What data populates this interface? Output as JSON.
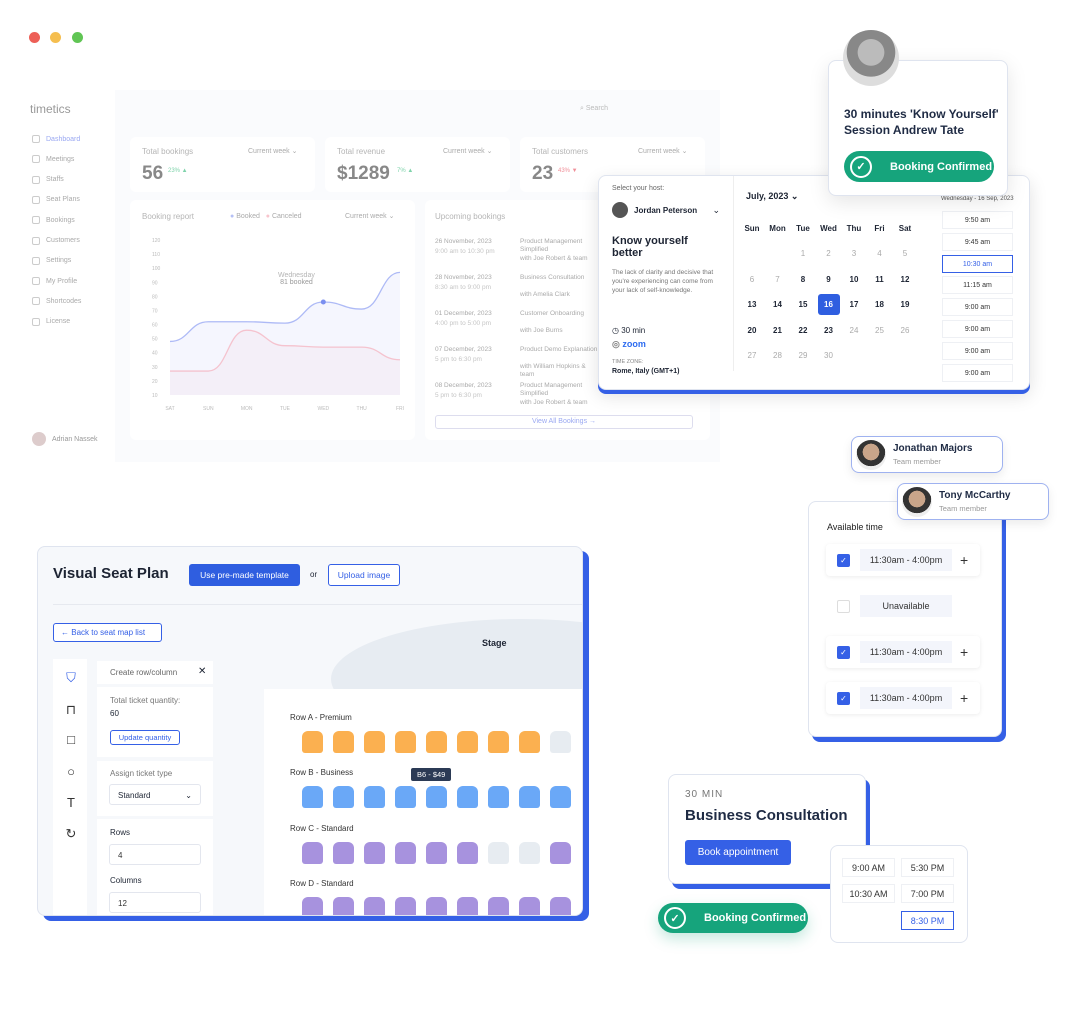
{
  "window": {
    "dots": [
      "#ed5f57",
      "#f5be4f",
      "#60c554"
    ]
  },
  "dashboard": {
    "logo": "timetics",
    "search_placeholder": "Search",
    "sidebar": [
      "Dashboard",
      "Meetings",
      "Staffs",
      "Seat Plans",
      "Bookings",
      "Customers",
      "Settings",
      "My Profile",
      "Shortcodes",
      "License"
    ],
    "user": "Adrian Nassek",
    "stats": [
      {
        "label": "Total bookings",
        "period": "Current week",
        "value": "56",
        "change": "23%",
        "trend": "up"
      },
      {
        "label": "Total revenue",
        "period": "Current week",
        "value": "$1289",
        "change": "7%",
        "trend": "up"
      },
      {
        "label": "Total customers",
        "period": "Current week",
        "value": "23",
        "change": "43%",
        "trend": "down"
      }
    ],
    "report": {
      "title": "Booking report",
      "legend_booked": "Booked",
      "legend_canceled": "Canceled",
      "period": "Current week",
      "tooltip_day": "Wednesday",
      "tooltip_value": "81 booked"
    },
    "upcoming": {
      "title": "Upcoming bookings",
      "view_all": "View All Bookings →",
      "items": [
        {
          "date": "26 November, 2023",
          "time": "9:00 am to 10:30 pm",
          "title": "Product Management Simplified",
          "with": "with Joe Robert & team"
        },
        {
          "date": "28 November, 2023",
          "time": "8:30 am to 9:00 pm",
          "title": "Business Consultation",
          "with": "with Amelia Clark"
        },
        {
          "date": "01 December, 2023",
          "time": "4:00 pm to 5:00 pm",
          "title": "Customer Onboarding",
          "with": "with Joe Burns"
        },
        {
          "date": "07 December, 2023",
          "time": "5 pm to 6:30 pm",
          "title": "Product Demo Explanation",
          "with": "with William Hopkins & team"
        },
        {
          "date": "08 December, 2023",
          "time": "5 pm to 6:30 pm",
          "title": "Product Management Simplified",
          "with": "with Joe Robert & team"
        }
      ]
    }
  },
  "chart_data": {
    "type": "line",
    "categories": [
      "SAT",
      "SUN",
      "MON",
      "TUE",
      "WED",
      "THU",
      "FRI"
    ],
    "yticks": [
      10,
      20,
      30,
      40,
      50,
      60,
      70,
      80,
      90,
      100,
      110,
      120
    ],
    "ylim": [
      10,
      120
    ],
    "series": [
      {
        "name": "Booked",
        "color": "#7b8ff0",
        "values": [
          48,
          62,
          62,
          61,
          76,
          71,
          97
        ]
      },
      {
        "name": "Canceled",
        "color": "#f5a3b0",
        "values": [
          27,
          27,
          56,
          45,
          44,
          44,
          35
        ]
      }
    ]
  },
  "booking_widget": {
    "select_host": "Select your host:",
    "host": "Jordan Peterson",
    "title": "Know yourself better",
    "desc": "The lack of clarity and decisive that you're experiencing can come from your lack of self-knowledge.",
    "duration": "30 min",
    "platform": "zoom",
    "tz_label": "TIME ZONE:",
    "tz": "Rome, Italy (GMT+1)",
    "month": "July, 2023",
    "weekdays": [
      "Sun",
      "Mon",
      "Tue",
      "Wed",
      "Thu",
      "Fri",
      "Sat"
    ],
    "selected_day": "16",
    "date_heading": "Wednesday - 16 Sep, 2023",
    "slots": [
      "9:50 am",
      "9:45 am",
      "10:30 am",
      "11:15 am",
      "9:00 am",
      "9:00 am",
      "9:00 am",
      "9:00 am"
    ],
    "selected_slot": "10:30 am"
  },
  "confirm_card": {
    "title": "30 minutes 'Know Yourself' Session Andrew Tate",
    "status": "Booking Confirmed"
  },
  "team": [
    {
      "name": "Jonathan Majors",
      "role": "Team member"
    },
    {
      "name": "Tony McCarthy",
      "role": "Team member"
    }
  ],
  "availability": {
    "title": "Available time",
    "rows": [
      {
        "checked": true,
        "label": "11:30am - 4:00pm"
      },
      {
        "checked": false,
        "label": "Unavailable"
      },
      {
        "checked": true,
        "label": "11:30am - 4:00pm"
      },
      {
        "checked": true,
        "label": "11:30am - 4:00pm"
      }
    ]
  },
  "consult": {
    "duration": "30 MIN",
    "title": "Business Consultation",
    "button": "Book appointment",
    "times": [
      "9:00 AM",
      "5:30 PM",
      "10:30 AM",
      "7:00 PM",
      "8:30 PM"
    ],
    "selected": "8:30 PM"
  },
  "confirm_pill": {
    "status": "Booking Confirmed"
  },
  "seat_plan": {
    "title": "Visual Seat Plan",
    "template_btn": "Use pre-made template",
    "or": "or",
    "upload_btn": "Upload image",
    "back_btn": "Back to seat map list",
    "stage": "Stage",
    "panel_title": "Create row/column",
    "total_label": "Total ticket quantity:",
    "total_value": "60",
    "update_btn": "Update quantity",
    "assign_label": "Assign ticket type",
    "ticket_type": "Standard",
    "rows_label": "Rows",
    "rows_value": "4",
    "cols_label": "Columns",
    "cols_value": "12",
    "tooltip": "B6 - $49",
    "colors": {
      "premium": "#fbb050",
      "business": "#6aa8f7",
      "standard": "#a792de",
      "empty": "#e7ecf1"
    },
    "rows": [
      {
        "label": "Row A - Premium",
        "seats": [
          "premium",
          "premium",
          "premium",
          "premium",
          "premium",
          "premium",
          "premium",
          "premium",
          "empty"
        ]
      },
      {
        "label": "Row B - Business",
        "seats": [
          "business",
          "business",
          "business",
          "business",
          "business",
          "business",
          "business",
          "business",
          "business"
        ]
      },
      {
        "label": "Row C - Standard",
        "seats": [
          "standard",
          "standard",
          "standard",
          "standard",
          "standard",
          "standard",
          "empty",
          "empty",
          "standard"
        ]
      },
      {
        "label": "Row D - Standard",
        "seats": [
          "standard",
          "standard",
          "standard",
          "standard",
          "standard",
          "standard",
          "standard",
          "standard",
          "standard"
        ]
      }
    ]
  }
}
